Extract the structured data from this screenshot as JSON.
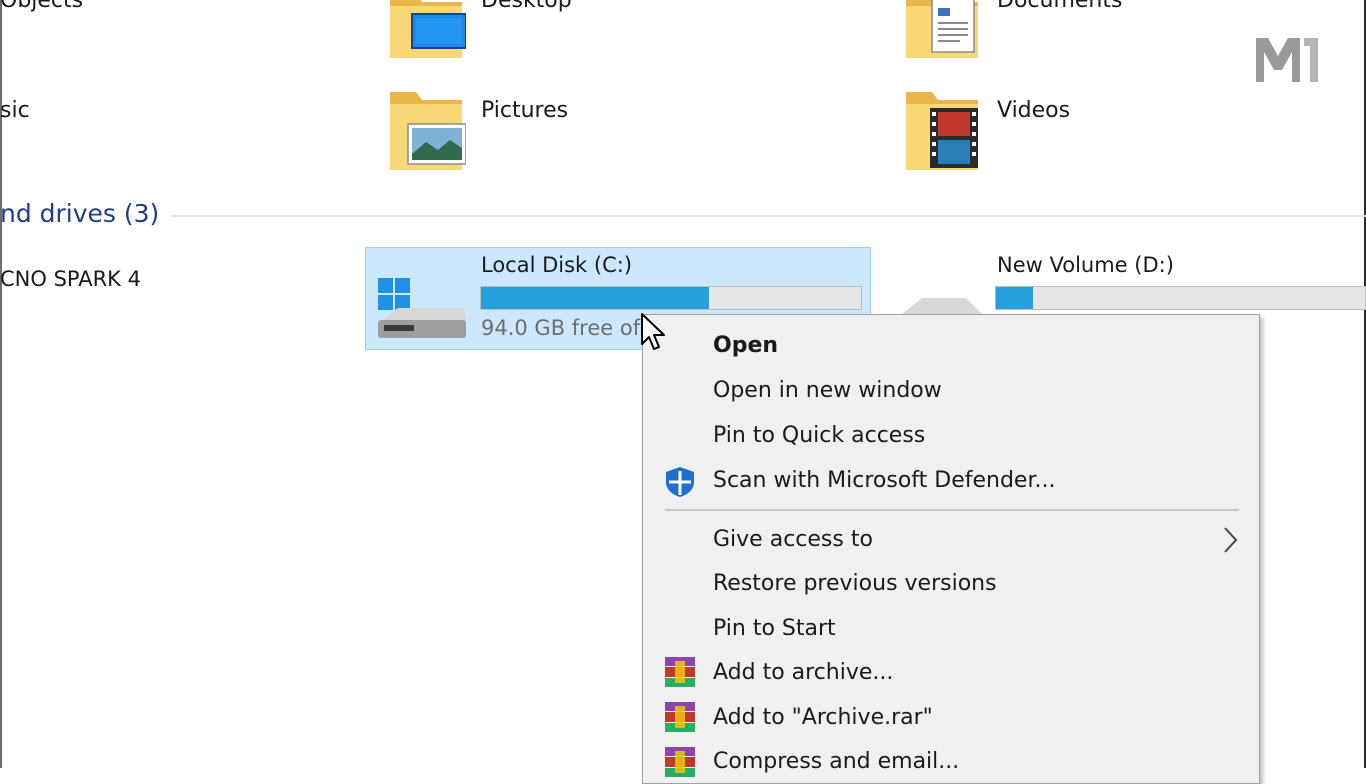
{
  "folders": {
    "objects_partial": "Objects",
    "desktop": "Desktop",
    "documents": "Documents",
    "music_partial": "sic",
    "pictures": "Pictures",
    "videos": "Videos"
  },
  "devices_section": {
    "title_partial": "nd drives (3)"
  },
  "devices": {
    "phone_partial": "CNO SPARK 4",
    "c_drive": {
      "name": "Local Disk (C:)",
      "free_text_partial": "94.0 GB free of",
      "used_fraction": 0.6
    },
    "d_drive": {
      "name": "New Volume (D:)",
      "used_fraction": 0.1
    }
  },
  "context_menu": {
    "items": [
      {
        "label": "Open",
        "bold": true
      },
      {
        "label": "Open in new window"
      },
      {
        "label": "Pin to Quick access"
      },
      {
        "label": "Scan with Microsoft Defender...",
        "icon": "defender-shield-icon"
      },
      {
        "label": "Give access to",
        "submenu": true
      },
      {
        "label": "Restore previous versions"
      },
      {
        "label": "Pin to Start"
      },
      {
        "label": "Add to archive...",
        "icon": "winrar-icon"
      },
      {
        "label": "Add to \"Archive.rar\"",
        "icon": "winrar-icon"
      },
      {
        "label": "Compress and email...",
        "icon": "winrar-icon"
      }
    ]
  },
  "colors": {
    "selection_bg": "#cce8ff",
    "progress_fill": "#26a0da",
    "section_header": "#1f3c88",
    "menu_bg": "#f0f0f0"
  }
}
